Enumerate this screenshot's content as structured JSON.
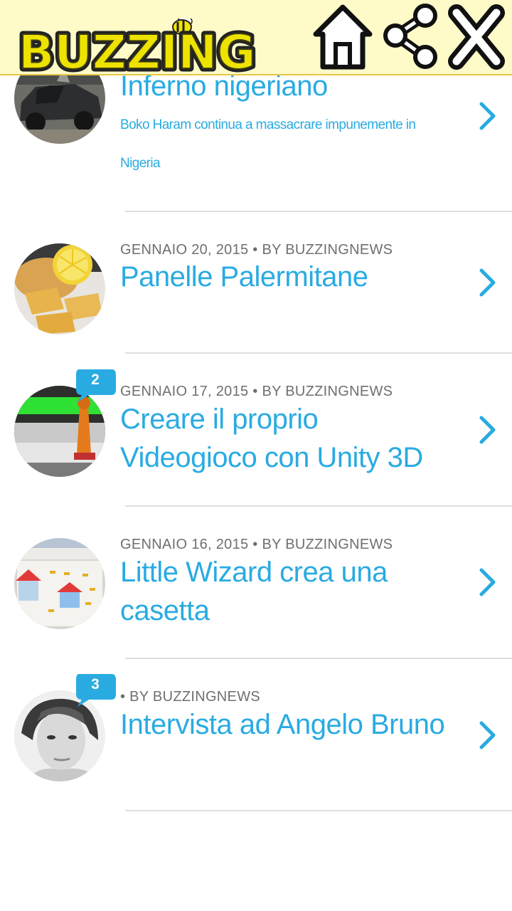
{
  "header": {
    "logo_text": "BUZZING",
    "home_icon": "home-icon",
    "share_icon": "share-icon",
    "close_icon": "close-icon",
    "background": "#fffbc8"
  },
  "posts": [
    {
      "meta": "",
      "title": "Inferno nigeriano",
      "excerpt": "Boko Haram continua a massacrare impunemente in Nigeria",
      "thumb": "burned-car-image"
    },
    {
      "meta": "GENNAIO 20, 2015 • BY BUZZINGNEWS",
      "title": "Panelle Palermitane",
      "thumb": "panelle-image"
    },
    {
      "meta": "GENNAIO 17, 2015 • BY BUZZINGNEWS",
      "title": "Creare il proprio Videogioco con Unity 3D",
      "comments": "2",
      "thumb": "videogame-image"
    },
    {
      "meta": "GENNAIO 16, 2015 • BY BUZZINGNEWS",
      "title": "Little Wizard crea una casetta",
      "thumb": "little-wizard-screenshot"
    },
    {
      "meta": "• BY BUZZINGNEWS",
      "title": "Intervista ad Angelo Bruno",
      "comments": "3",
      "thumb": "portrait-image"
    }
  ],
  "colors": {
    "accent": "#29abe2",
    "meta_text": "#6f6f6f",
    "divider": "#dedede",
    "logo_yellow": "#f2e600"
  }
}
